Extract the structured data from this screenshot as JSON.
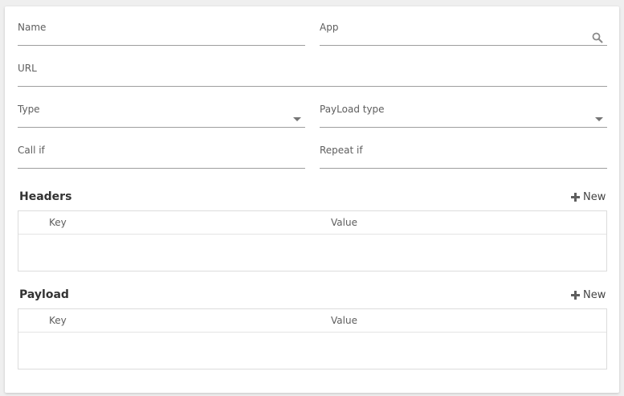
{
  "form": {
    "name": {
      "label": "Name",
      "value": ""
    },
    "app": {
      "label": "App",
      "value": "",
      "icon": "search-icon"
    },
    "url": {
      "label": "URL",
      "value": ""
    },
    "type": {
      "label": "Type",
      "value": "",
      "icon": "chevron-down-icon"
    },
    "payload_type": {
      "label": "PayLoad type",
      "value": "",
      "icon": "chevron-down-icon"
    },
    "call_if": {
      "label": "Call if",
      "value": ""
    },
    "repeat_if": {
      "label": "Repeat if",
      "value": ""
    }
  },
  "headers": {
    "title": "Headers",
    "new_label": "New",
    "columns": [
      "Key",
      "Value"
    ]
  },
  "payload": {
    "title": "Payload",
    "new_label": "New",
    "columns": [
      "Key",
      "Value"
    ]
  }
}
